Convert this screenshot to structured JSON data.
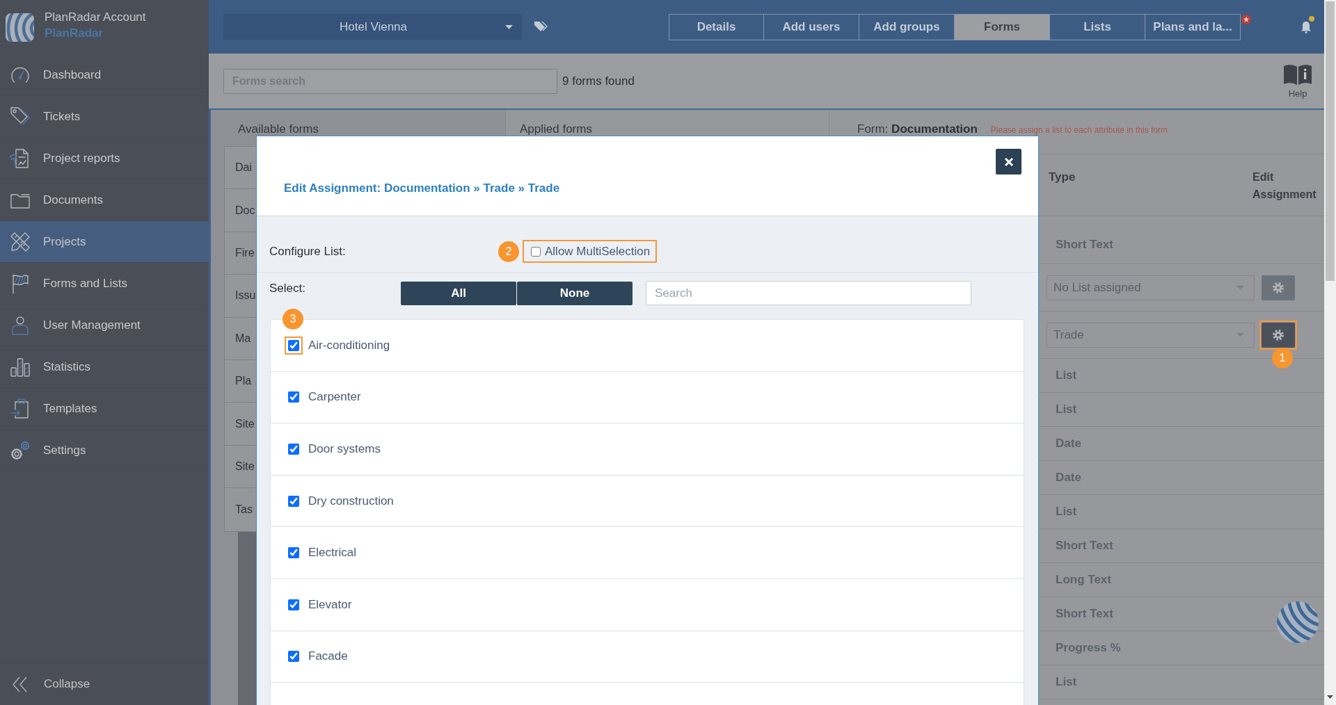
{
  "sidebar": {
    "account": "PlanRadar Account",
    "company": "PlanRadar",
    "items": [
      {
        "kind": "dashboard",
        "label": "Dashboard",
        "selected": false
      },
      {
        "kind": "tickets",
        "label": "Tickets",
        "selected": false
      },
      {
        "kind": "reports",
        "label": "Project reports",
        "selected": false
      },
      {
        "kind": "documents",
        "label": "Documents",
        "selected": false
      },
      {
        "kind": "projects",
        "label": "Projects",
        "selected": true
      },
      {
        "kind": "forms",
        "label": "Forms and Lists",
        "selected": false
      },
      {
        "kind": "users",
        "label": "User Management",
        "selected": false
      },
      {
        "kind": "statistics",
        "label": "Statistics",
        "selected": false
      },
      {
        "kind": "templates",
        "label": "Templates",
        "selected": false
      },
      {
        "kind": "settings",
        "label": "Settings",
        "selected": false
      }
    ],
    "collapse": "Collapse"
  },
  "header": {
    "project": "Hotel Vienna",
    "tabs": [
      {
        "label": "Details",
        "selected": false
      },
      {
        "label": "Add users",
        "selected": false
      },
      {
        "label": "Add groups",
        "selected": false
      },
      {
        "label": "Forms",
        "selected": true
      },
      {
        "label": "Lists",
        "selected": false
      },
      {
        "label": "Plans and la...",
        "selected": false
      }
    ],
    "notifications_unread": true
  },
  "toolbar": {
    "search": {
      "placeholder": "Forms search"
    },
    "result_count": "9 forms found",
    "help": "Help"
  },
  "available_forms": {
    "title": "Available forms",
    "items": [
      "Dai",
      "Doc",
      "Fire",
      "Issu",
      "Ma",
      "Pla",
      "Site",
      "Site",
      "Tas"
    ]
  },
  "applied_forms": {
    "title": "Applied forms"
  },
  "form_panel": {
    "title": "Form: **Documentation**",
    "warning": "Please assign a list to each attribute in this form",
    "columns": [
      "Type",
      "Edit Assignment"
    ],
    "rows": [
      {
        "kind": "text",
        "type": "Short Text"
      },
      {
        "kind": "select",
        "value": "No List assigned",
        "disabled": true,
        "highlighted": false
      },
      {
        "kind": "select",
        "value": "Trade",
        "disabled": false,
        "highlighted": true,
        "callout": "1"
      },
      {
        "kind": "text",
        "type": "List"
      },
      {
        "kind": "text",
        "type": "List"
      },
      {
        "kind": "text",
        "type": "Date"
      },
      {
        "kind": "text",
        "type": "Date"
      },
      {
        "kind": "text",
        "type": "List"
      },
      {
        "kind": "text",
        "type": "Short Text"
      },
      {
        "kind": "text",
        "type": "Long Text"
      },
      {
        "kind": "text",
        "type": "Short Text"
      },
      {
        "kind": "text",
        "type": "Progress %"
      },
      {
        "kind": "text",
        "type": "List"
      }
    ]
  },
  "modal": {
    "title": "Edit Assignment: Documentation » Trade » Trade",
    "configure_label": "Configure List:",
    "multi_selection": {
      "label": "Allow MultiSelection",
      "checked": false,
      "highlighted": true,
      "callout": "2"
    },
    "select_label": "Select:",
    "select_buttons": [
      "All",
      "None"
    ],
    "search": {
      "placeholder": "Search"
    },
    "items": [
      {
        "label": "Air-conditioning",
        "checked": true,
        "highlighted": true,
        "callout": "3"
      },
      {
        "label": "Carpenter",
        "checked": true,
        "highlighted": false
      },
      {
        "label": "Door systems",
        "checked": true,
        "highlighted": false
      },
      {
        "label": "Dry construction",
        "checked": true,
        "highlighted": false
      },
      {
        "label": "Electrical",
        "checked": true,
        "highlighted": false
      },
      {
        "label": "Elevator",
        "checked": true,
        "highlighted": false
      },
      {
        "label": "Facade",
        "checked": true,
        "highlighted": false
      }
    ]
  }
}
